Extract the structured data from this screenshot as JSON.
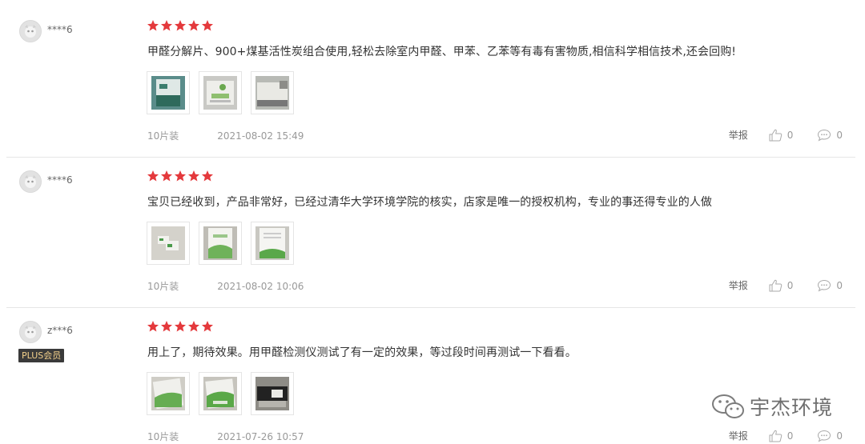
{
  "reviews": [
    {
      "username": "****6",
      "badge": "",
      "rating": 5,
      "comment": "甲醛分解片、900+煤基活性炭组合使用,轻松去除室内甲醛、甲苯、乙苯等有毒有害物质,相信科学相信技术,还会回购!",
      "spec": "10片装",
      "date": "2021-08-02 15:49",
      "report_label": "举报",
      "likes": "0",
      "comments": "0"
    },
    {
      "username": "****6",
      "badge": "",
      "rating": 5,
      "comment": "宝贝已经收到，产品非常好，已经过清华大学环境学院的核实，店家是唯一的授权机构，专业的事还得专业的人做",
      "spec": "10片装",
      "date": "2021-08-02 10:06",
      "report_label": "举报",
      "likes": "0",
      "comments": "0"
    },
    {
      "username": "z***6",
      "badge": "PLUS会员",
      "rating": 5,
      "comment": "用上了，期待效果。用甲醛检测仪测试了有一定的效果，等过段时间再测试一下看看。",
      "spec": "10片装",
      "date": "2021-07-26 10:57",
      "report_label": "举报",
      "likes": "0",
      "comments": "0"
    }
  ],
  "watermark": "宇杰环境",
  "colors": {
    "star": "#e4393c",
    "divider": "#e6e6e6",
    "badge_bg": "#3a3a3a",
    "badge_text": "#f2d08b"
  }
}
